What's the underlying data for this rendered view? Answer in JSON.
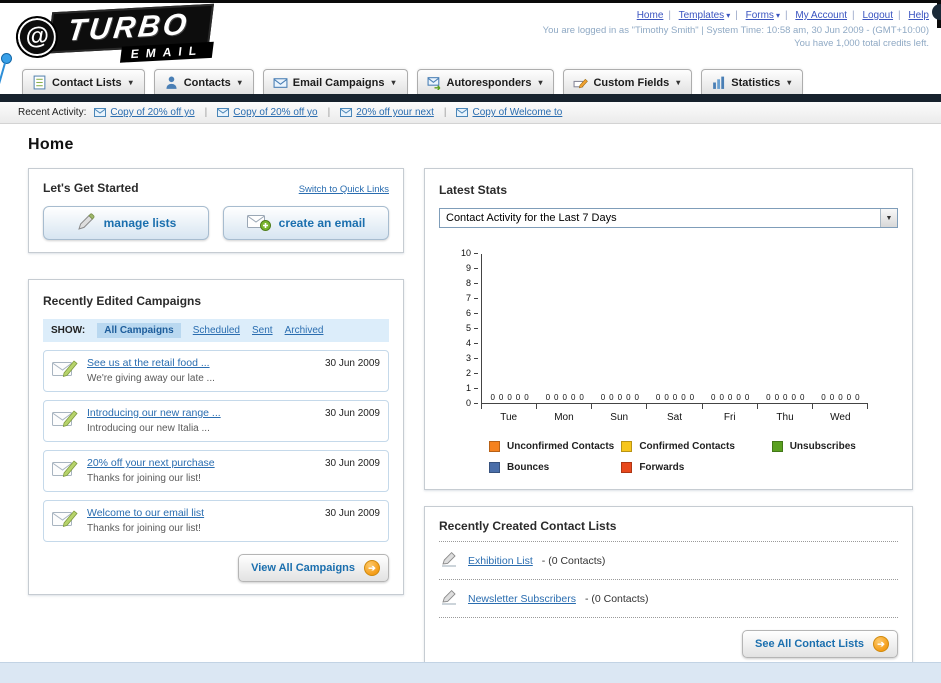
{
  "icons": {
    "caret": "▾",
    "select_arrow": "▼",
    "arrow": "➔",
    "logo_swirl": "@"
  },
  "header": {
    "logo_line1": "TURBO",
    "logo_line2": "EMAIL",
    "top_links": [
      {
        "label": "Home"
      },
      {
        "label": "Templates"
      },
      {
        "label": "Forms"
      },
      {
        "label": "My Account"
      },
      {
        "label": "Logout"
      },
      {
        "label": "Help"
      }
    ],
    "session_line": "You are logged in as \"Timothy Smith\" | System Time: 10:58 am, 30 Jun 2009 - (GMT+10:00)",
    "credits_line": "You have 1,000 total credits left."
  },
  "nav": {
    "tabs": [
      {
        "label": "Contact Lists"
      },
      {
        "label": "Contacts"
      },
      {
        "label": "Email Campaigns"
      },
      {
        "label": "Autoresponders"
      },
      {
        "label": "Custom Fields"
      },
      {
        "label": "Statistics"
      }
    ]
  },
  "recent_activity": {
    "label": "Recent Activity:",
    "items": [
      "Copy of 20% off yo",
      "Copy of 20% off yo",
      "20% off your next",
      "Copy of Welcome to"
    ]
  },
  "page": {
    "title": "Home"
  },
  "get_started": {
    "title": "Let's Get Started",
    "switch_link": "Switch to Quick Links",
    "manage_lists_button": "manage lists",
    "create_email_button": "create an email"
  },
  "campaigns": {
    "title": "Recently Edited Campaigns",
    "show_label": "SHOW:",
    "filters": [
      "All Campaigns",
      "Scheduled",
      "Sent",
      "Archived"
    ],
    "active_filter": "All Campaigns",
    "items": [
      {
        "title": "See us at the retail food ...",
        "subtitle": "We're giving away our late ...",
        "date": "30 Jun 2009"
      },
      {
        "title": "Introducing our new range ...",
        "subtitle": "Introducing our new Italia ...",
        "date": "30 Jun 2009"
      },
      {
        "title": "20% off your next purchase",
        "subtitle": "Thanks for joining our list!",
        "date": "30 Jun 2009"
      },
      {
        "title": "Welcome to our email list",
        "subtitle": "Thanks for joining our list!",
        "date": "30 Jun 2009"
      }
    ],
    "view_all_button": "View All Campaigns"
  },
  "latest_stats": {
    "title": "Latest Stats",
    "selected_option": "Contact Activity for the Last 7 Days"
  },
  "chart_data": {
    "type": "bar",
    "title": "Contact Activity for the Last 7 Days",
    "categories": [
      "Tue",
      "Mon",
      "Sun",
      "Sat",
      "Fri",
      "Thu",
      "Wed"
    ],
    "series": [
      {
        "name": "Unconfirmed Contacts",
        "color": "#f5821f",
        "values": [
          0,
          0,
          0,
          0,
          0,
          0,
          0
        ]
      },
      {
        "name": "Confirmed Contacts",
        "color": "#f7c61c",
        "values": [
          0,
          0,
          0,
          0,
          0,
          0,
          0
        ]
      },
      {
        "name": "Unsubscribes",
        "color": "#5aa020",
        "values": [
          0,
          0,
          0,
          0,
          0,
          0,
          0
        ]
      },
      {
        "name": "Bounces",
        "color": "#4a6ea9",
        "values": [
          0,
          0,
          0,
          0,
          0,
          0,
          0
        ]
      },
      {
        "name": "Forwards",
        "color": "#e8491d",
        "values": [
          0,
          0,
          0,
          0,
          0,
          0,
          0
        ]
      }
    ],
    "ylim": [
      0,
      10
    ],
    "yticks": [
      0,
      1,
      2,
      3,
      4,
      5,
      6,
      7,
      8,
      9,
      10
    ],
    "grid": false,
    "legend_position": "bottom"
  },
  "contact_lists": {
    "title": "Recently Created Contact Lists",
    "items": [
      {
        "name": "Exhibition List",
        "count": "- (0 Contacts)"
      },
      {
        "name": "Newsletter Subscribers",
        "count": "- (0 Contacts)"
      }
    ],
    "see_all_button": "See All Contact Lists"
  },
  "colors": {
    "link_blue": "#2a6db0",
    "top_link_blue": "#3a54c0",
    "navy_bar": "#17222d",
    "accent_orange": "#f59d18"
  }
}
